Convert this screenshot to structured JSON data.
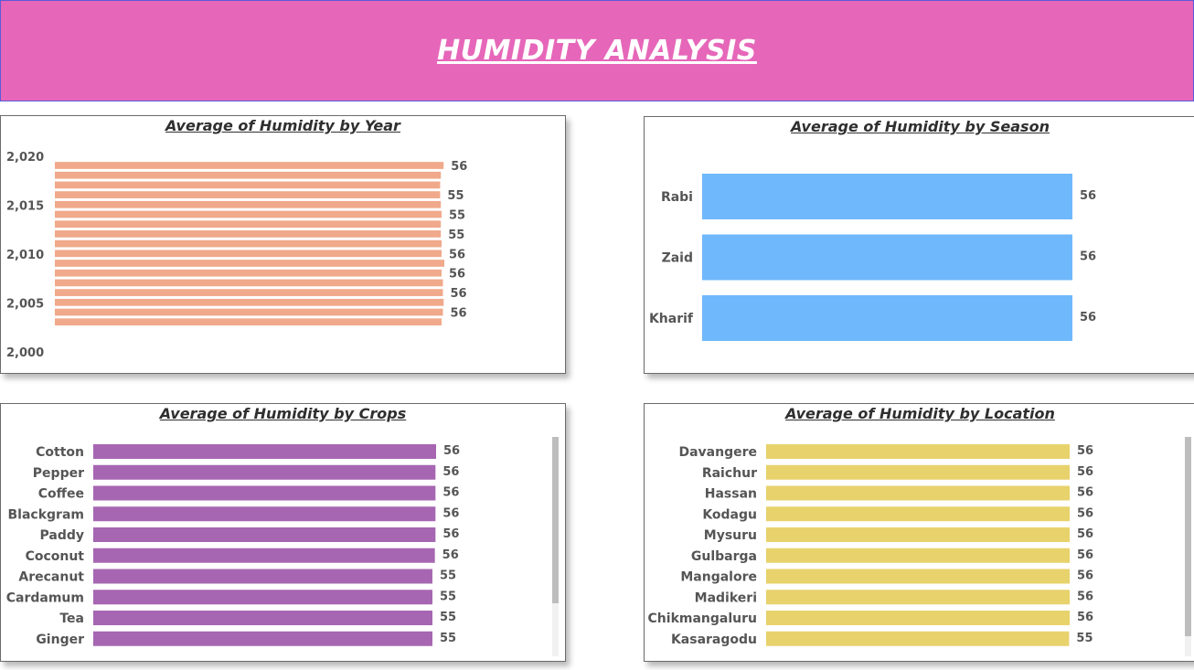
{
  "header": {
    "title": "HUMIDITY ANALYSIS"
  },
  "colors": {
    "banner": "#e667b9",
    "year": "#f0a98a",
    "season": "#6fb8fc",
    "crops": "#a666b1",
    "location": "#e8d26c"
  },
  "panels": {
    "year": {
      "title": "Average of Humidity by Year"
    },
    "season": {
      "title": "Average of Humidity by Season"
    },
    "crops": {
      "title": "Average of Humidity by Crops"
    },
    "location": {
      "title": "Average of Humidity by Location"
    }
  },
  "chart_data": [
    {
      "id": "year",
      "type": "bar",
      "orientation": "horizontal",
      "title": "Average of Humidity by Year",
      "y_axis_ticks": [
        "2,020",
        "2,015",
        "2,010",
        "2,005",
        "2,000"
      ],
      "y_range": [
        2000,
        2020
      ],
      "categories": [
        2020,
        2019,
        2018,
        2017,
        2016,
        2015,
        2014,
        2013,
        2012,
        2011,
        2010,
        2009,
        2008,
        2007,
        2006,
        2005,
        2004
      ],
      "values": [
        55.9,
        55.5,
        55.4,
        55.4,
        55.5,
        55.6,
        55.5,
        55.5,
        55.6,
        55.6,
        56.0,
        55.6,
        55.8,
        55.8,
        55.9,
        55.8,
        55.6
      ],
      "data_labels": [
        {
          "year": 2020,
          "text": "56"
        },
        {
          "year": 2017,
          "text": "55"
        },
        {
          "year": 2015,
          "text": "55"
        },
        {
          "year": 2013,
          "text": "55"
        },
        {
          "year": 2011,
          "text": "56"
        },
        {
          "year": 2009,
          "text": "56"
        },
        {
          "year": 2007,
          "text": "56"
        },
        {
          "year": 2005,
          "text": "56"
        }
      ],
      "xlim": [
        0,
        56
      ]
    },
    {
      "id": "season",
      "type": "bar",
      "orientation": "horizontal",
      "title": "Average of Humidity by Season",
      "categories": [
        "Rabi",
        "Zaid",
        "Kharif"
      ],
      "values": [
        56,
        56,
        56
      ],
      "data_labels": [
        "56",
        "56",
        "56"
      ],
      "xlim": [
        0,
        56
      ]
    },
    {
      "id": "crops",
      "type": "bar",
      "orientation": "horizontal",
      "title": "Average of Humidity by Crops",
      "categories": [
        "Cotton",
        "Pepper",
        "Coffee",
        "Blackgram",
        "Paddy",
        "Coconut",
        "Arecanut",
        "Cardamum",
        "Tea",
        "Ginger"
      ],
      "values": [
        56,
        55.9,
        55.9,
        55.9,
        55.9,
        55.8,
        55.4,
        55.4,
        55.4,
        55.4
      ],
      "data_labels": [
        "56",
        "56",
        "56",
        "56",
        "56",
        "56",
        "55",
        "55",
        "55",
        "55"
      ],
      "xlim": [
        0,
        56
      ]
    },
    {
      "id": "location",
      "type": "bar",
      "orientation": "horizontal",
      "title": "Average of Humidity by Location",
      "categories": [
        "Davangere",
        "Raichur",
        "Hassan",
        "Kodagu",
        "Mysuru",
        "Gulbarga",
        "Mangalore",
        "Madikeri",
        "Chikmangaluru",
        "Kasaragodu"
      ],
      "values": [
        56,
        56,
        56,
        56,
        56,
        56,
        56,
        56,
        56,
        55.9
      ],
      "data_labels": [
        "56",
        "56",
        "56",
        "56",
        "56",
        "56",
        "56",
        "56",
        "56",
        "55"
      ],
      "xlim": [
        0,
        56
      ]
    }
  ]
}
